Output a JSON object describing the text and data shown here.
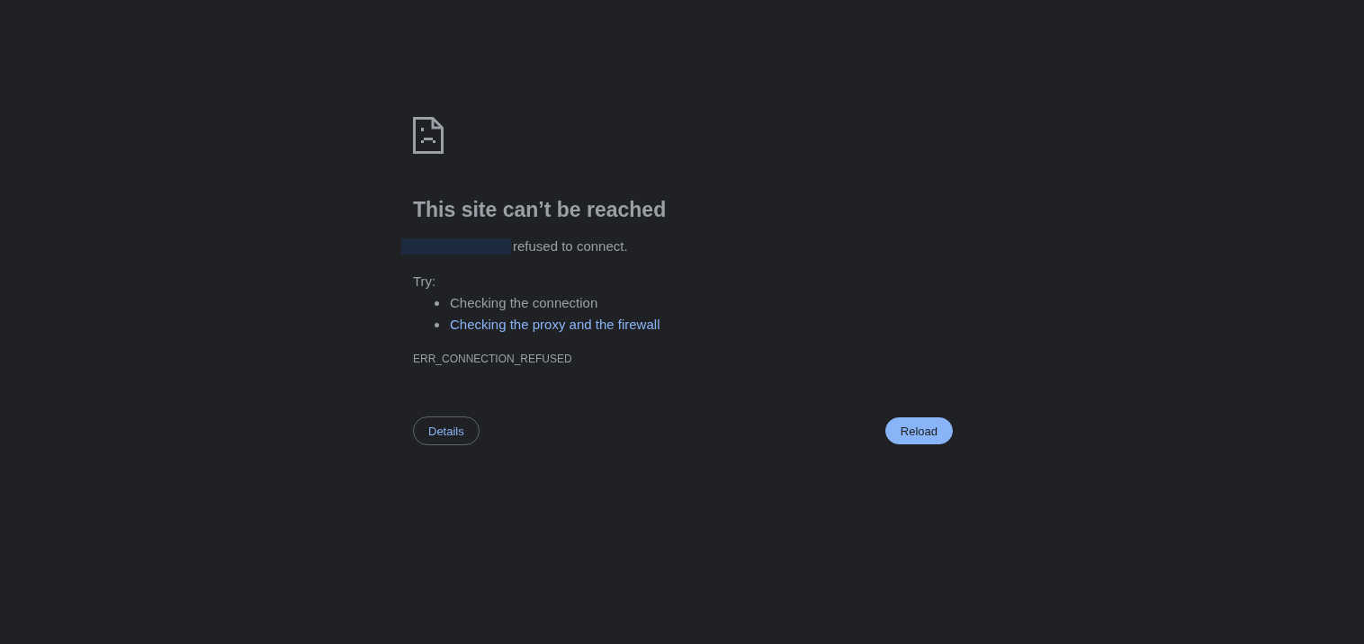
{
  "error_page": {
    "title": "This site can’t be reached",
    "message": "refused to connect.",
    "try_label": "Try:",
    "suggestions": [
      {
        "kind": "text",
        "label": "Checking the connection"
      },
      {
        "kind": "link",
        "label": "Checking the proxy and the firewall"
      }
    ],
    "error_code": "ERR_CONNECTION_REFUSED",
    "buttons": [
      {
        "kind": "secondary",
        "label": "Details"
      },
      {
        "kind": "primary",
        "label": "Reload"
      }
    ]
  }
}
